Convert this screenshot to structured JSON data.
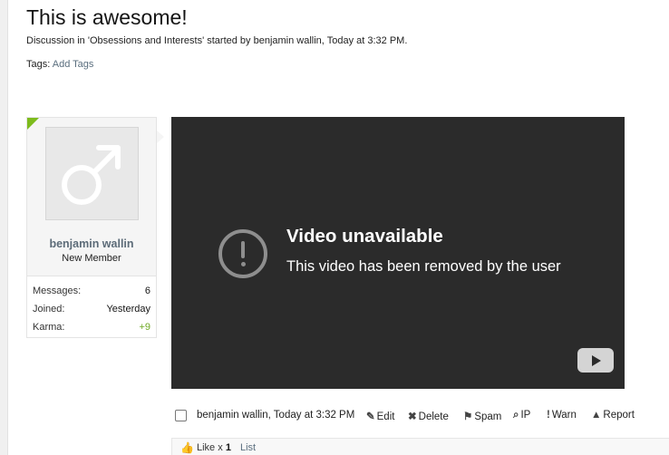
{
  "thread": {
    "title": "This is awesome!",
    "meta": "Discussion in 'Obsessions and Interests' started by benjamin wallin, Today at 3:32 PM.",
    "tags_label": "Tags:",
    "add_tags": "Add Tags"
  },
  "user": {
    "name": "benjamin wallin",
    "title": "New Member",
    "stats": [
      {
        "label": "Messages:",
        "value": "6"
      },
      {
        "label": "Joined:",
        "value": "Yesterday"
      },
      {
        "label": "Karma:",
        "value": "+9"
      }
    ]
  },
  "video": {
    "title": "Video unavailable",
    "message": "This video has been removed by the user"
  },
  "post": {
    "byline": "benjamin wallin, Today at 3:32 PM",
    "actions": {
      "edit": "Edit",
      "delete": "Delete",
      "spam": "Spam",
      "ip": "IP",
      "warn": "Warn",
      "report": "Report"
    }
  },
  "likes": {
    "label": "Like x",
    "count": "1",
    "list": "List"
  },
  "colors": {
    "new_member_flag": "#7dbb1c",
    "karma_positive": "#6ea923",
    "link": "#5a6e7e",
    "video_bg": "#2b2b2b"
  }
}
